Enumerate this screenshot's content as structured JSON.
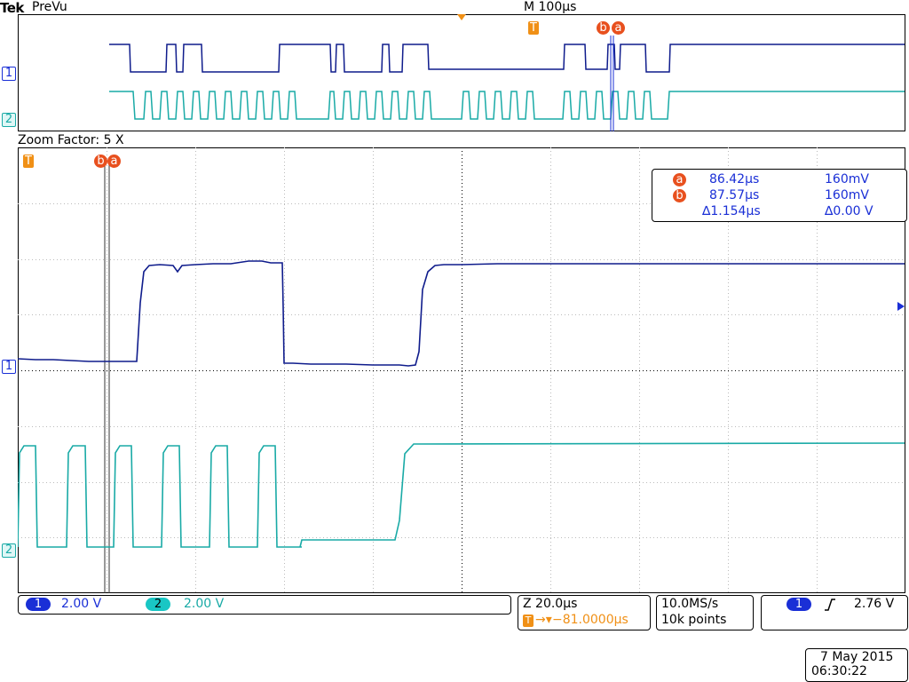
{
  "header": {
    "brand": "Tek",
    "mode": "PreVu",
    "timebase": "M 100µs"
  },
  "overview": {
    "markers": {
      "trigger": "T",
      "cursor_b": "b",
      "cursor_a": "a"
    },
    "ch1_label": "1",
    "ch2_label": "2"
  },
  "zoom": {
    "label": "Zoom Factor: 5 X",
    "markers": {
      "trigger": "T",
      "cursor_b": "b",
      "cursor_a": "a"
    },
    "ch1_label": "1",
    "ch2_label": "2"
  },
  "cursor_readout": {
    "a": {
      "marker": "a",
      "time": "86.42µs",
      "volts": "160mV"
    },
    "b": {
      "marker": "b",
      "time": "87.57µs",
      "volts": "160mV"
    },
    "delta": {
      "time": "∆1.154µs",
      "volts": "∆0.00 V"
    }
  },
  "status": {
    "ch1": {
      "label": "1",
      "scale": "2.00 V",
      "color": "#1a2fd6"
    },
    "ch2": {
      "label": "2",
      "scale": "2.00 V",
      "color": "#19c6c4"
    },
    "zoom_time": "Z 20.0µs",
    "trigger_position": "−81.0000µs",
    "sample_rate": "10.0MS/s",
    "record_length": "10k points",
    "trigger_source": "1",
    "trigger_level": "2.76 V",
    "date": "7 May 2015",
    "time": "06:30:22"
  },
  "colors": {
    "ch1": "#0f1c8c",
    "ch2": "#19aaa6",
    "marker": "#f09016",
    "cursor": "#e8501e",
    "readout": "#1a2fd6"
  }
}
